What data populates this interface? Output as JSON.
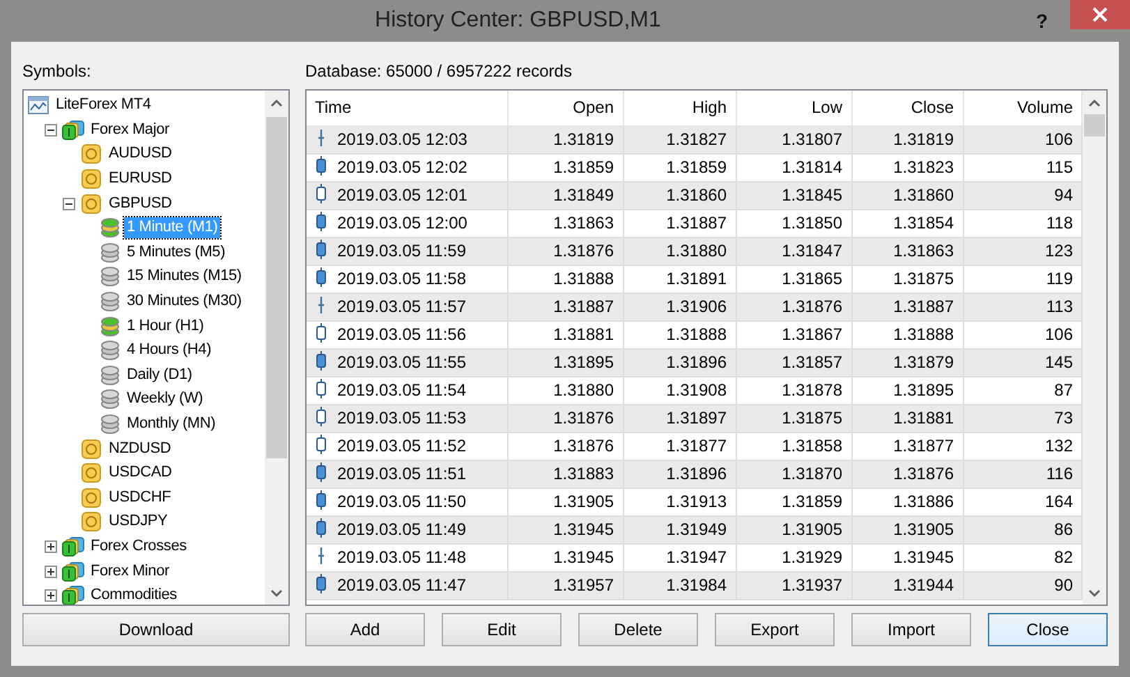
{
  "window": {
    "title": "History Center: GBPUSD,M1",
    "help": "?"
  },
  "symbols": {
    "label": "Symbols:",
    "tree": [
      {
        "label": "LiteForex MT4",
        "kind": "root",
        "selected": false,
        "children": [
          {
            "label": "Forex Major",
            "kind": "group",
            "selected": false,
            "expanded": true,
            "children": [
              {
                "label": "AUDUSD",
                "kind": "symbol",
                "selected": false
              },
              {
                "label": "EURUSD",
                "kind": "symbol",
                "selected": false
              },
              {
                "label": "GBPUSD",
                "kind": "symbol",
                "selected": false,
                "expanded": true,
                "children": [
                  {
                    "label": "1 Minute (M1)",
                    "kind": "timeframe",
                    "has_data": true,
                    "selected": true
                  },
                  {
                    "label": "5 Minutes (M5)",
                    "kind": "timeframe",
                    "has_data": false,
                    "selected": false
                  },
                  {
                    "label": "15 Minutes (M15)",
                    "kind": "timeframe",
                    "has_data": false,
                    "selected": false
                  },
                  {
                    "label": "30 Minutes (M30)",
                    "kind": "timeframe",
                    "has_data": false,
                    "selected": false
                  },
                  {
                    "label": "1 Hour (H1)",
                    "kind": "timeframe",
                    "has_data": true,
                    "selected": false
                  },
                  {
                    "label": "4 Hours (H4)",
                    "kind": "timeframe",
                    "has_data": false,
                    "selected": false
                  },
                  {
                    "label": "Daily (D1)",
                    "kind": "timeframe",
                    "has_data": false,
                    "selected": false
                  },
                  {
                    "label": "Weekly (W)",
                    "kind": "timeframe",
                    "has_data": false,
                    "selected": false
                  },
                  {
                    "label": "Monthly (MN)",
                    "kind": "timeframe",
                    "has_data": false,
                    "selected": false
                  }
                ]
              },
              {
                "label": "NZDUSD",
                "kind": "symbol",
                "selected": false
              },
              {
                "label": "USDCAD",
                "kind": "symbol",
                "selected": false
              },
              {
                "label": "USDCHF",
                "kind": "symbol",
                "selected": false
              },
              {
                "label": "USDJPY",
                "kind": "symbol",
                "selected": false
              }
            ]
          },
          {
            "label": "Forex Crosses",
            "kind": "group",
            "selected": false,
            "expanded": false
          },
          {
            "label": "Forex Minor",
            "kind": "group",
            "selected": false,
            "expanded": false
          },
          {
            "label": "Commodities",
            "kind": "group",
            "selected": false,
            "expanded": false
          }
        ]
      }
    ]
  },
  "database": {
    "label": "Database: 65000 / 6957222 records"
  },
  "table": {
    "columns": [
      "Time",
      "Open",
      "High",
      "Low",
      "Close",
      "Volume"
    ],
    "rows": [
      {
        "kind": "doji",
        "cells": [
          "2019.03.05 12:03",
          "1.31819",
          "1.31827",
          "1.31807",
          "1.31819",
          "106"
        ]
      },
      {
        "kind": "bearish",
        "cells": [
          "2019.03.05 12:02",
          "1.31859",
          "1.31859",
          "1.31814",
          "1.31823",
          "115"
        ]
      },
      {
        "kind": "bullish",
        "cells": [
          "2019.03.05 12:01",
          "1.31849",
          "1.31860",
          "1.31845",
          "1.31860",
          "94"
        ]
      },
      {
        "kind": "bearish",
        "cells": [
          "2019.03.05 12:00",
          "1.31863",
          "1.31887",
          "1.31850",
          "1.31854",
          "118"
        ]
      },
      {
        "kind": "bearish",
        "cells": [
          "2019.03.05 11:59",
          "1.31876",
          "1.31880",
          "1.31847",
          "1.31863",
          "123"
        ]
      },
      {
        "kind": "bearish",
        "cells": [
          "2019.03.05 11:58",
          "1.31888",
          "1.31891",
          "1.31865",
          "1.31875",
          "119"
        ]
      },
      {
        "kind": "doji",
        "cells": [
          "2019.03.05 11:57",
          "1.31887",
          "1.31906",
          "1.31876",
          "1.31887",
          "113"
        ]
      },
      {
        "kind": "bullish",
        "cells": [
          "2019.03.05 11:56",
          "1.31881",
          "1.31888",
          "1.31867",
          "1.31888",
          "106"
        ]
      },
      {
        "kind": "bearish",
        "cells": [
          "2019.03.05 11:55",
          "1.31895",
          "1.31896",
          "1.31857",
          "1.31879",
          "145"
        ]
      },
      {
        "kind": "bullish",
        "cells": [
          "2019.03.05 11:54",
          "1.31880",
          "1.31908",
          "1.31878",
          "1.31895",
          "87"
        ]
      },
      {
        "kind": "bullish",
        "cells": [
          "2019.03.05 11:53",
          "1.31876",
          "1.31897",
          "1.31875",
          "1.31881",
          "73"
        ]
      },
      {
        "kind": "bullish",
        "cells": [
          "2019.03.05 11:52",
          "1.31876",
          "1.31877",
          "1.31858",
          "1.31877",
          "132"
        ]
      },
      {
        "kind": "bearish",
        "cells": [
          "2019.03.05 11:51",
          "1.31883",
          "1.31896",
          "1.31870",
          "1.31876",
          "116"
        ]
      },
      {
        "kind": "bearish",
        "cells": [
          "2019.03.05 11:50",
          "1.31905",
          "1.31913",
          "1.31859",
          "1.31886",
          "164"
        ]
      },
      {
        "kind": "bearish",
        "cells": [
          "2019.03.05 11:49",
          "1.31945",
          "1.31949",
          "1.31905",
          "1.31905",
          "86"
        ]
      },
      {
        "kind": "doji",
        "cells": [
          "2019.03.05 11:48",
          "1.31945",
          "1.31947",
          "1.31929",
          "1.31945",
          "82"
        ]
      },
      {
        "kind": "bearish",
        "cells": [
          "2019.03.05 11:47",
          "1.31957",
          "1.31984",
          "1.31937",
          "1.31944",
          "90"
        ]
      }
    ]
  },
  "left_buttons": [
    {
      "label": "Download",
      "default": false
    }
  ],
  "right_buttons": [
    {
      "label": "Add",
      "default": false
    },
    {
      "label": "Edit",
      "default": false
    },
    {
      "label": "Delete",
      "default": false
    },
    {
      "label": "Export",
      "default": false
    },
    {
      "label": "Import",
      "default": false
    },
    {
      "label": "Close",
      "default": true
    }
  ]
}
